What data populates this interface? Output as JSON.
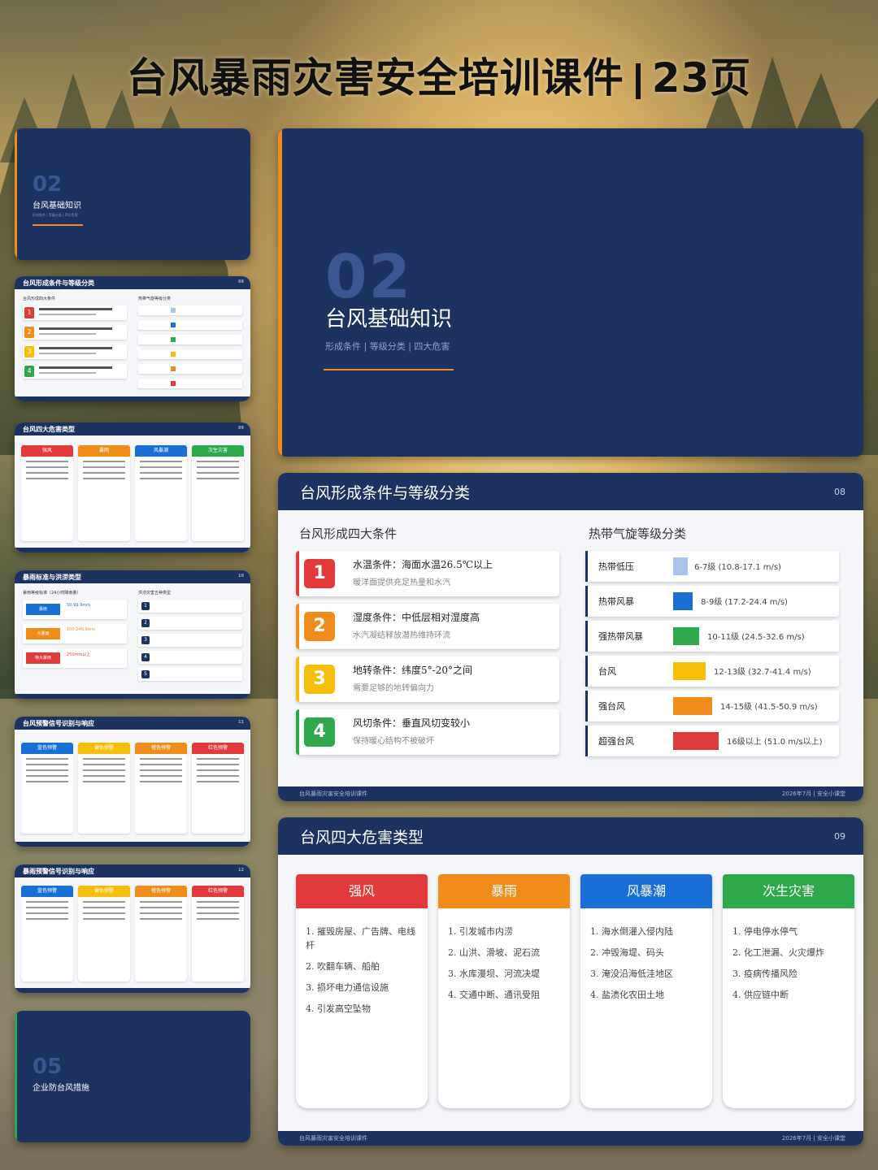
{
  "page": {
    "title": "台风暴雨灾害安全培训课件",
    "count": "23页"
  },
  "colors": {
    "navy": "#1c3361",
    "orange": "#f08c1a",
    "red": "#e03a3a",
    "yellow": "#f5be0b",
    "green": "#2ea84a",
    "blue": "#1a6fd6"
  },
  "section02": {
    "num": "02",
    "name": "台风基础知识",
    "sub": "形成条件 | 等级分类 | 四大危害"
  },
  "section05": {
    "num": "05",
    "name": "企业防台风措施"
  },
  "slide08": {
    "title": "台风形成条件与等级分类",
    "page": "08",
    "left_title": "台风形成四大条件",
    "right_title": "热带气旋等级分类",
    "conditions": [
      {
        "n": "1",
        "head": "水温条件：海面水温26.5℃以上",
        "desc": "暖洋面提供充足热量和水汽"
      },
      {
        "n": "2",
        "head": "湿度条件：中低层相对湿度高",
        "desc": "水汽凝结释放潜热维持环流"
      },
      {
        "n": "3",
        "head": "地转条件：纬度5°-20°之间",
        "desc": "需要足够的地转偏向力"
      },
      {
        "n": "4",
        "head": "风切条件：垂直风切变较小",
        "desc": "保持暖心结构不被破坏"
      }
    ],
    "levels": [
      {
        "name": "热带低压",
        "value": "6-7级 (10.8-17.1 m/s)",
        "color": "#a9c4ec"
      },
      {
        "name": "热带风暴",
        "value": "8-9级 (17.2-24.4 m/s)",
        "color": "#1a6fd6"
      },
      {
        "name": "强热带风暴",
        "value": "10-11级 (24.5-32.6 m/s)",
        "color": "#2ea84a"
      },
      {
        "name": "台风",
        "value": "12-13级 (32.7-41.4 m/s)",
        "color": "#f5be0b"
      },
      {
        "name": "强台风",
        "value": "14-15级 (41.5-50.9 m/s)",
        "color": "#f08c1a"
      },
      {
        "name": "超强台风",
        "value": "16级以上 (51.0 m/s以上)",
        "color": "#e03a3a"
      }
    ],
    "footer_left": "台风暴雨灾害安全培训课件",
    "footer_right": "2026年7月 | 安全小课堂"
  },
  "slide09": {
    "title": "台风四大危害类型",
    "page": "09",
    "hazards": [
      {
        "name": "强风",
        "color": "#e03a3a",
        "items": [
          "1. 摧毁房屋、广告牌、电线杆",
          "2. 吹翻车辆、船舶",
          "3. 损坏电力通信设施",
          "4. 引发高空坠物"
        ]
      },
      {
        "name": "暴雨",
        "color": "#f08c1a",
        "items": [
          "1. 引发城市内涝",
          "2. 山洪、滑坡、泥石流",
          "3. 水库漫坝、河流决堤",
          "4. 交通中断、通讯受阻"
        ]
      },
      {
        "name": "风暴潮",
        "color": "#1a6fd6",
        "items": [
          "1. 海水倒灌入侵内陆",
          "2. 冲毁海堤、码头",
          "3. 淹没沿海低洼地区",
          "4. 盐渍化农田土地"
        ]
      },
      {
        "name": "次生灾害",
        "color": "#2ea84a",
        "items": [
          "1. 停电停水停气",
          "2. 化工泄漏、火灾爆炸",
          "3. 疫病传播风险",
          "4. 供应链中断"
        ]
      }
    ],
    "footer_left": "台风暴雨灾害安全培训课件",
    "footer_right": "2026年7月 | 安全小课堂"
  },
  "thumbs": {
    "t08": {
      "title": "台风形成条件与等级分类",
      "page": "08",
      "left": "台风形成四大条件",
      "right": "热带气旋等级分类"
    },
    "t09": {
      "title": "台风四大危害类型",
      "page": "09",
      "cards": [
        "强风",
        "暴雨",
        "风暴潮",
        "次生灾害"
      ]
    },
    "t10": {
      "title": "暴雨标准与洪涝类型",
      "page": "10",
      "left": "暴雨等级标准（24小时降雨量）",
      "right": "洪涝灾害五种类型",
      "rows": [
        "暴雨",
        "大暴雨",
        "特大暴雨"
      ],
      "vals": [
        "50-99.9mm",
        "100-249.9mm",
        "250mm以上"
      ]
    },
    "t11": {
      "title": "台风预警信号识别与响应",
      "page": "11",
      "cards": [
        "蓝色预警",
        "黄色预警",
        "橙色预警",
        "红色预警"
      ]
    },
    "t12": {
      "title": "暴雨预警信号识别与响应",
      "page": "12",
      "cards": [
        "蓝色预警",
        "黄色预警",
        "橙色预警",
        "红色预警"
      ]
    }
  }
}
